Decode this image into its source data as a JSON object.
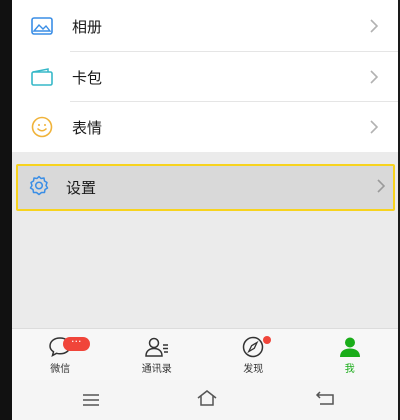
{
  "menu": {
    "items": [
      {
        "label": "相册",
        "icon": "album-icon"
      },
      {
        "label": "卡包",
        "icon": "card-wallet-icon"
      },
      {
        "label": "表情",
        "icon": "sticker-smile-icon"
      }
    ],
    "settings": {
      "label": "设置",
      "icon": "gear-icon"
    }
  },
  "tabs": [
    {
      "label": "微信",
      "icon": "chat-icon",
      "badge": "···"
    },
    {
      "label": "通讯录",
      "icon": "contacts-icon"
    },
    {
      "label": "发现",
      "icon": "compass-icon"
    },
    {
      "label": "我",
      "icon": "me-person-icon",
      "active": true
    }
  ],
  "colors": {
    "accent": "#1aad19",
    "highlight": "#f7d31e",
    "badge": "#f0453a",
    "icon_blue": "#3a8ee6"
  }
}
